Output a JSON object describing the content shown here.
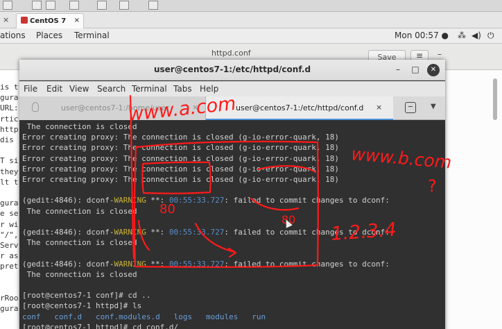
{
  "vm": {
    "tab_label": "CentOS 7",
    "tab_close": "×"
  },
  "gnome": {
    "applications": "ations",
    "places": "Places",
    "terminal": "Terminal",
    "clock": "Mon 00:57 ●",
    "icons": [
      "network-icon",
      "volume-icon",
      "power-icon"
    ]
  },
  "gedit": {
    "title": "httpd.conf",
    "save_label": "Save",
    "menu_glyph": "≡",
    "min_glyph": "–",
    "left_fragments": [
      "is t",
      "gura",
      "URL:",
      "rtic",
      "http",
      " dis",
      "",
      "T si",
      "they",
      "lt t",
      "",
      "gura",
      "e se",
      "r wi",
      "\"/\",",
      "Serv",
      "r as",
      "pret",
      "",
      "",
      "rRoo",
      "gura"
    ]
  },
  "terminal": {
    "title": "user@centos7-1:/etc/httpd/conf.d",
    "menu": [
      "File",
      "Edit",
      "View",
      "Search",
      "Terminal",
      "Tabs",
      "Help"
    ],
    "tabs": [
      {
        "label": "user@centos7-1:/home/user",
        "close": "×"
      },
      {
        "label": "user@centos7-1:/etc/httpd/conf.d",
        "close": "×"
      }
    ],
    "lines": {
      "l1": " The connection is closed",
      "l2": "Error creating proxy: The connection is closed (g-io-error-quark, 18)",
      "l3": "Error creating proxy: The connection is closed (g-io-error-quark, 18)",
      "l4": "Error creating proxy: The connection is closed (g-io-error-quark, 18)",
      "l5": "Error creating proxy: The connection is closed (g-io-error-quark, 18)",
      "l6": "Error creating proxy: The connection is closed (g-io-error-quark, 18)",
      "w_prefix": "(gedit:4846): dconf-",
      "w_word": "WARNING",
      "w_mid": " **: ",
      "w_time": "00:55:33.727",
      "w_tail": ": failed to commit changes to dconf:",
      "closed": " The connection is closed",
      "p1": "[root@centos7-1 conf]# cd ..",
      "p2": "[root@centos7-1 httpd]# ls",
      "ls": [
        "conf",
        "conf.d",
        "conf.modules.d",
        "logs",
        "modules",
        "run"
      ],
      "p3": "[root@centos7-1 httpd]# cd conf.d/"
    }
  },
  "annotations": {
    "a1": "www.a.com",
    "a2": "www.b.com",
    "a3": "80",
    "a4": "80",
    "a5": "?",
    "a6": "1.2.3.4"
  },
  "colors": {
    "annotation": "#ff1a1a",
    "terminal_bg": "#303030",
    "warning": "#c9b338",
    "timestamp": "#5a8ec8"
  }
}
